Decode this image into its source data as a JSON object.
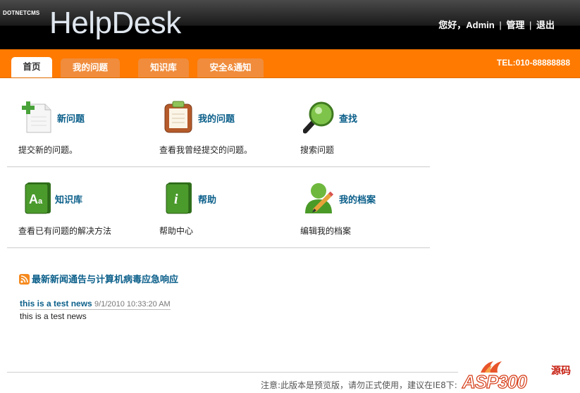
{
  "header": {
    "brand_small": "Dotnetcms",
    "brand": "HelpDesk",
    "greeting": "您好，Admin",
    "manage": "管理",
    "logout": "退出",
    "separator": "|"
  },
  "nav": {
    "tabs": [
      {
        "label": "首页",
        "active": true
      },
      {
        "label": "我的问题",
        "active": false
      },
      {
        "label": "知识库",
        "active": false
      },
      {
        "label": "安全&通知",
        "active": false
      }
    ],
    "tel": "TEL:010-88888888"
  },
  "grid": [
    {
      "title": "新问题",
      "desc": "提交新的问题。",
      "icon": "new-document-plus-icon"
    },
    {
      "title": "我的问题",
      "desc": "查看我曾经提交的问题。",
      "icon": "clipboard-icon"
    },
    {
      "title": "查找",
      "desc": "搜索问题",
      "icon": "magnifier-icon"
    },
    {
      "title": "知识库",
      "desc": "查看已有问题的解决方法",
      "icon": "green-book-aa-icon"
    },
    {
      "title": "帮助",
      "desc": "帮助中心",
      "icon": "green-book-info-icon"
    },
    {
      "title": "我的档案",
      "desc": "编辑我的档案",
      "icon": "user-pencil-icon"
    }
  ],
  "news": {
    "heading": "最新新闻通告与计算机病毒应急响应",
    "items": [
      {
        "title": "this is a test news",
        "date": "9/1/2010 10:33:20 AM",
        "body": "this is a test news"
      }
    ]
  },
  "footer": {
    "note": "注意:此版本是预览版，请勿正式使用，建议在IE8下:"
  },
  "watermark": {
    "text": "ASP300",
    "cn": "源码"
  },
  "colors": {
    "nav_orange": "#ff7a00",
    "tab_orange": "#f08c3c",
    "link_blue": "#0b5f8a"
  }
}
